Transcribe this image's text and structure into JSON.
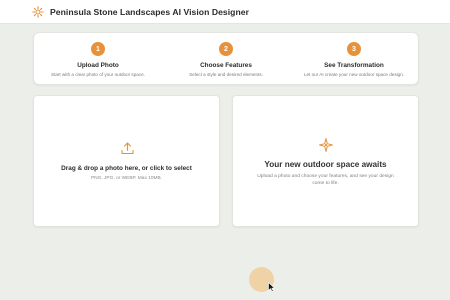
{
  "app": {
    "title": "Peninsula Stone Landscapes AI Vision Designer",
    "logo_icon": "sparkle-sun-icon",
    "accent": "#e7923a"
  },
  "steps": [
    {
      "number": "1",
      "title": "Upload Photo",
      "description": "Start with a clear photo of your outdoor space."
    },
    {
      "number": "2",
      "title": "Choose Features",
      "description": "Select a style and desired elements."
    },
    {
      "number": "3",
      "title": "See Transformation",
      "description": "Let our AI create your new outdoor space design."
    }
  ],
  "upload": {
    "icon": "upload-icon",
    "title": "Drag & drop a photo here, or click to select",
    "subtitle": "PNG, JPG, or WEBP. Max 10MB."
  },
  "preview": {
    "icon": "sparkle-icon",
    "title": "Your new outdoor space awaits",
    "subtitle": "Upload a photo and choose your features, and see your design come to life."
  }
}
